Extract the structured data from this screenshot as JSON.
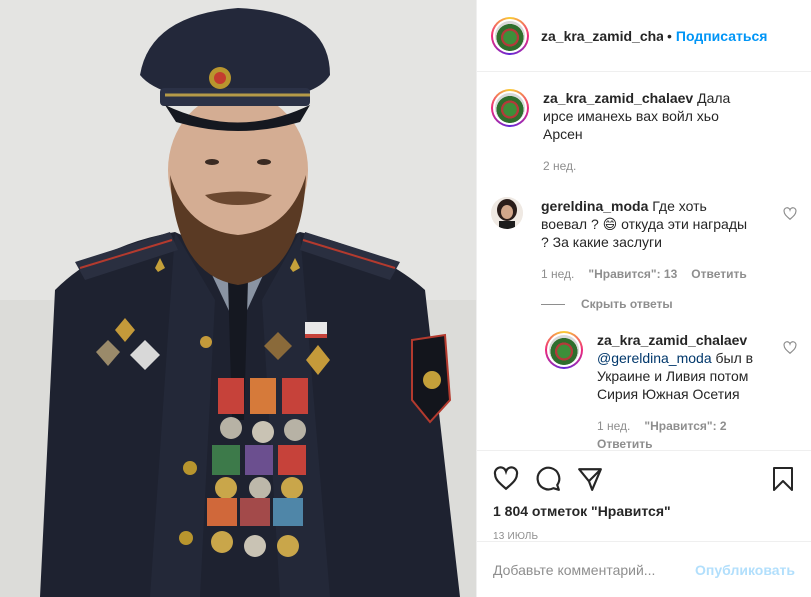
{
  "header": {
    "username": "za_kra_zamid_chala",
    "dot": "•",
    "follow_label": "Подписаться"
  },
  "caption": {
    "username": "za_kra_zamid_chalaev",
    "text": "Дала ирсе иманехь вах войл хьо Арсен",
    "time": "2 нед."
  },
  "comment": {
    "username": "gereldina_moda",
    "text": "Где хоть воевал ? 😄 откуда эти награды ? За какие заслуги",
    "time": "1 нед.",
    "likes": "\"Нравится\": 13",
    "reply_label": "Ответить",
    "hide_replies": "Скрыть ответы"
  },
  "reply": {
    "username": "za_kra_zamid_chalaev",
    "mention": "@gereldina_moda",
    "text": " был в Украине и Ливия потом Сирия Южная Осетия",
    "time": "1 нед.",
    "likes": "\"Нравится\": 2",
    "reply_label": "Ответить"
  },
  "likes_count": "1 804 отметок \"Нравится\"",
  "post_date": "13 ИЮЛЬ",
  "add_comment": {
    "placeholder": "Добавьте комментарий...",
    "publish_label": "Опубликовать"
  },
  "colors": {
    "accent": "#0095f6",
    "muted": "#8e8e8e",
    "publish_disabled": "#b2dffc"
  }
}
